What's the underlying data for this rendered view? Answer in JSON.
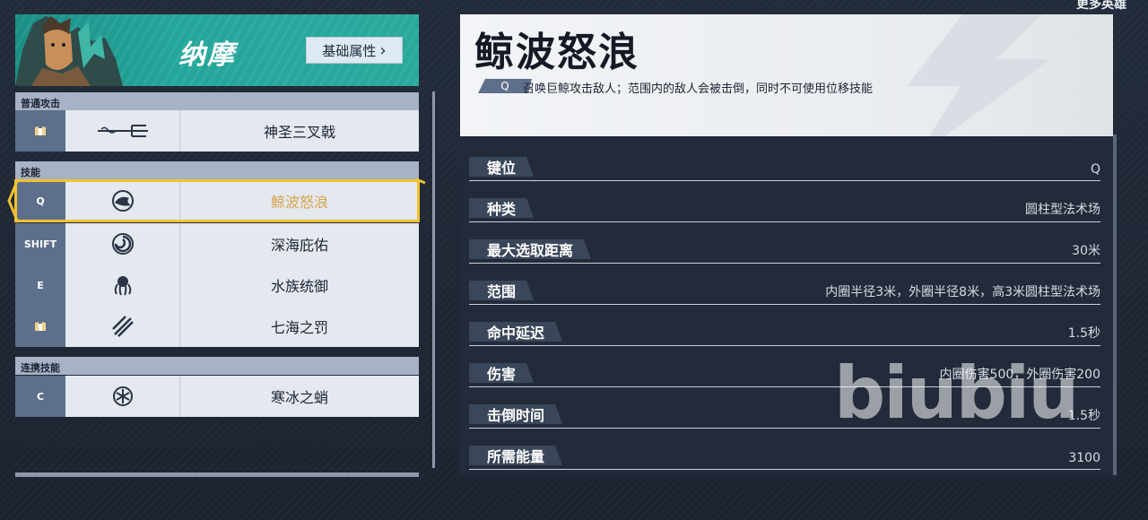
{
  "header": {
    "more_heroes": "更多英雄"
  },
  "hero": {
    "name": "纳摩",
    "attr_button": "基础属性",
    "attr_chevron": "›"
  },
  "sections": {
    "normal_attack": "普通攻击",
    "skills": "技能",
    "team_up": "连携技能"
  },
  "rows": [
    {
      "key": "",
      "icon": "trident-icon",
      "name": "神圣三叉戟"
    },
    {
      "key": "Q",
      "icon": "whale-icon",
      "name": "鲸波怒浪"
    },
    {
      "key": "SHIFT",
      "icon": "vortex-icon",
      "name": "深海庇佑"
    },
    {
      "key": "E",
      "icon": "octopus-icon",
      "name": "水族统御"
    },
    {
      "key": "",
      "icon": "slash-icon",
      "name": "七海之罚"
    },
    {
      "key": "C",
      "icon": "snowflake-icon",
      "name": "寒冰之蛸"
    }
  ],
  "detail": {
    "title": "鲸波怒浪",
    "key": "Q",
    "description": "召唤巨鲸攻击敌人；范围内的敌人会被击倒，同时不可使用位移技能",
    "stats": [
      {
        "label": "键位",
        "value": "Q"
      },
      {
        "label": "种类",
        "value": "圆柱型法术场"
      },
      {
        "label": "最大选取距离",
        "value": "30米"
      },
      {
        "label": "范围",
        "value": "内圈半径3米，外圈半径8米，高3米圆柱型法术场"
      },
      {
        "label": "命中延迟",
        "value": "1.5秒"
      },
      {
        "label": "伤害",
        "value": "内圈伤害500，外圈伤害200"
      },
      {
        "label": "击倒时间",
        "value": "1.5秒"
      },
      {
        "label": "所需能量",
        "value": "3100"
      }
    ]
  },
  "watermark": "biubiu",
  "colors": {
    "teal": "#24a69b",
    "selected_outline": "#f1c22e",
    "selected_text": "#d9a54c",
    "key_bg": "#5d6f8a"
  }
}
